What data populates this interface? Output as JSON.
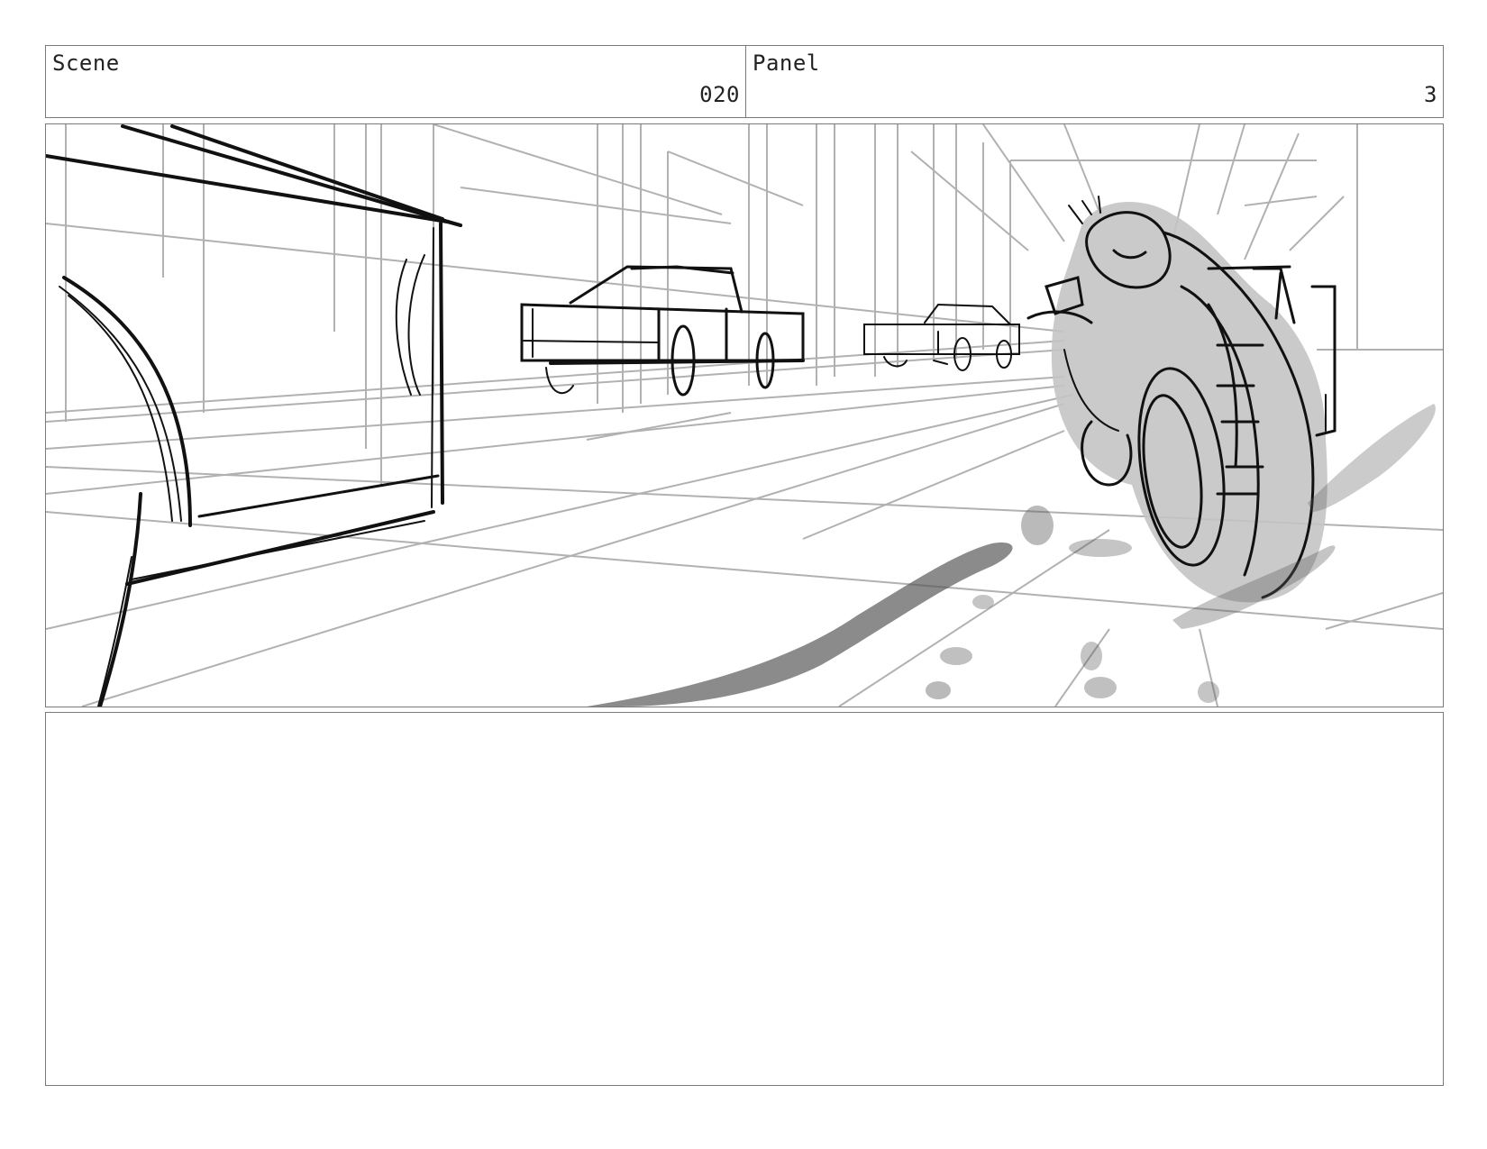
{
  "header": {
    "scene_label": "Scene",
    "scene_number": "020",
    "panel_label": "Panel",
    "panel_number": "3"
  },
  "frame": {
    "subject": "sketch",
    "colors": {
      "ink": "#111111",
      "guide": "#9a9a9a",
      "shade": "#bdbdbd"
    }
  },
  "notes": {
    "text": ""
  }
}
